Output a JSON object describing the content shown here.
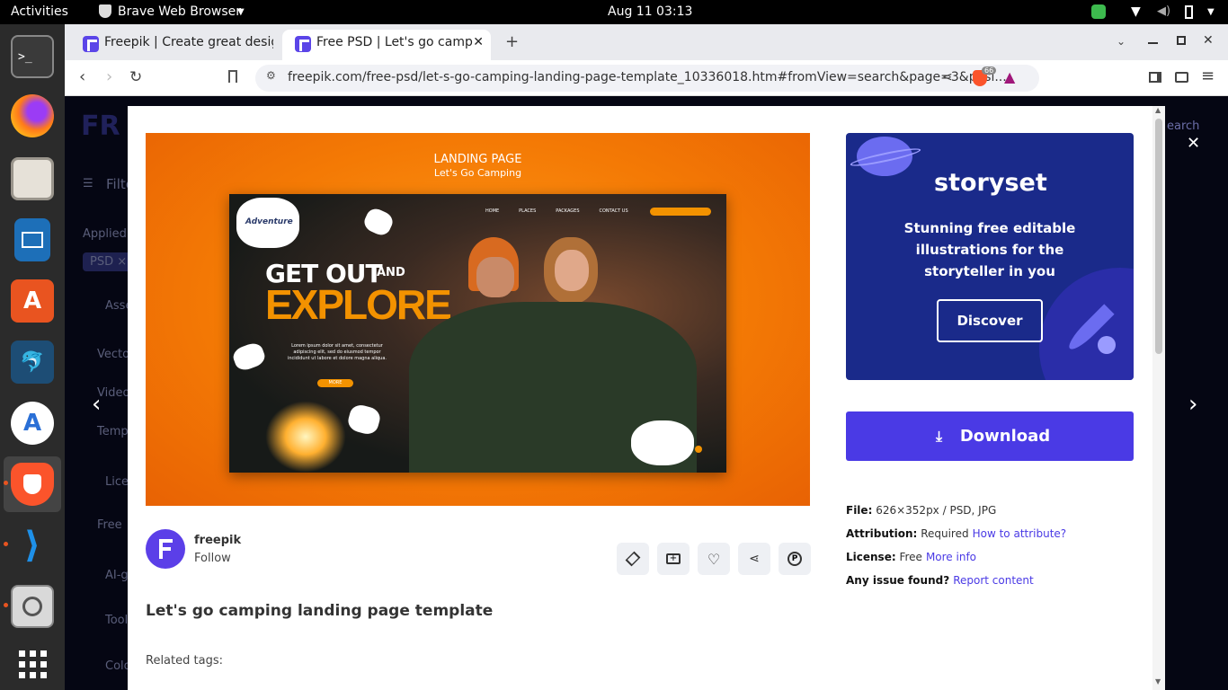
{
  "system": {
    "activities": "Activities",
    "app_name": "Brave Web Browser",
    "clock": "Aug 11  03:13"
  },
  "tabs": [
    {
      "label": "Freepik | Create great desig"
    },
    {
      "label": "Free PSD | Let's go camp"
    }
  ],
  "url": "freepik.com/free-psd/let-s-go-camping-landing-page-template_10336018.htm#fromView=search&page=3&posi...",
  "brave_badge": "66",
  "sidebar": {
    "filters": "Filte",
    "applied": "Applied",
    "chip": "PSD ×",
    "assets": "Asse",
    "items": [
      "Vecto",
      "Video",
      "Temp"
    ],
    "license": "Lice",
    "free": "Free",
    "ai": "AI-g",
    "tools": "Tool",
    "color": "Colo"
  },
  "header": {
    "logo": "FR",
    "search": "earch"
  },
  "preview": {
    "title": "LANDING PAGE",
    "subtitle": "Let's Go Camping",
    "nav": [
      "HOME",
      "PLACES",
      "PACKAGES",
      "CONTACT US"
    ],
    "logo_text": "Adventure",
    "headline1": "GET OUT",
    "headline_and": "AND",
    "headline2": "EXPLORE",
    "body": "Lorem ipsum dolor sit amet, consectetur adipiscing elit, sed do eiusmod tempor incididunt ut labore et dolore magna aliqua.",
    "more": "MORE"
  },
  "author": {
    "name": "freepik",
    "follow": "Follow"
  },
  "asset_title": "Let's go camping landing page template",
  "related_tags": "Related tags:",
  "ad": {
    "brand": "storyset",
    "text": "Stunning free editable illustrations for the storyteller in you",
    "button": "Discover"
  },
  "download": "Download",
  "meta": {
    "file_label": "File:",
    "file_value": "626×352px / PSD, JPG",
    "attr_label": "Attribution:",
    "attr_value": "Required",
    "attr_link": "How to attribute?",
    "lic_label": "License:",
    "lic_value": "Free",
    "lic_link": "More info",
    "issue_label": "Any issue found?",
    "issue_link": "Report content"
  }
}
